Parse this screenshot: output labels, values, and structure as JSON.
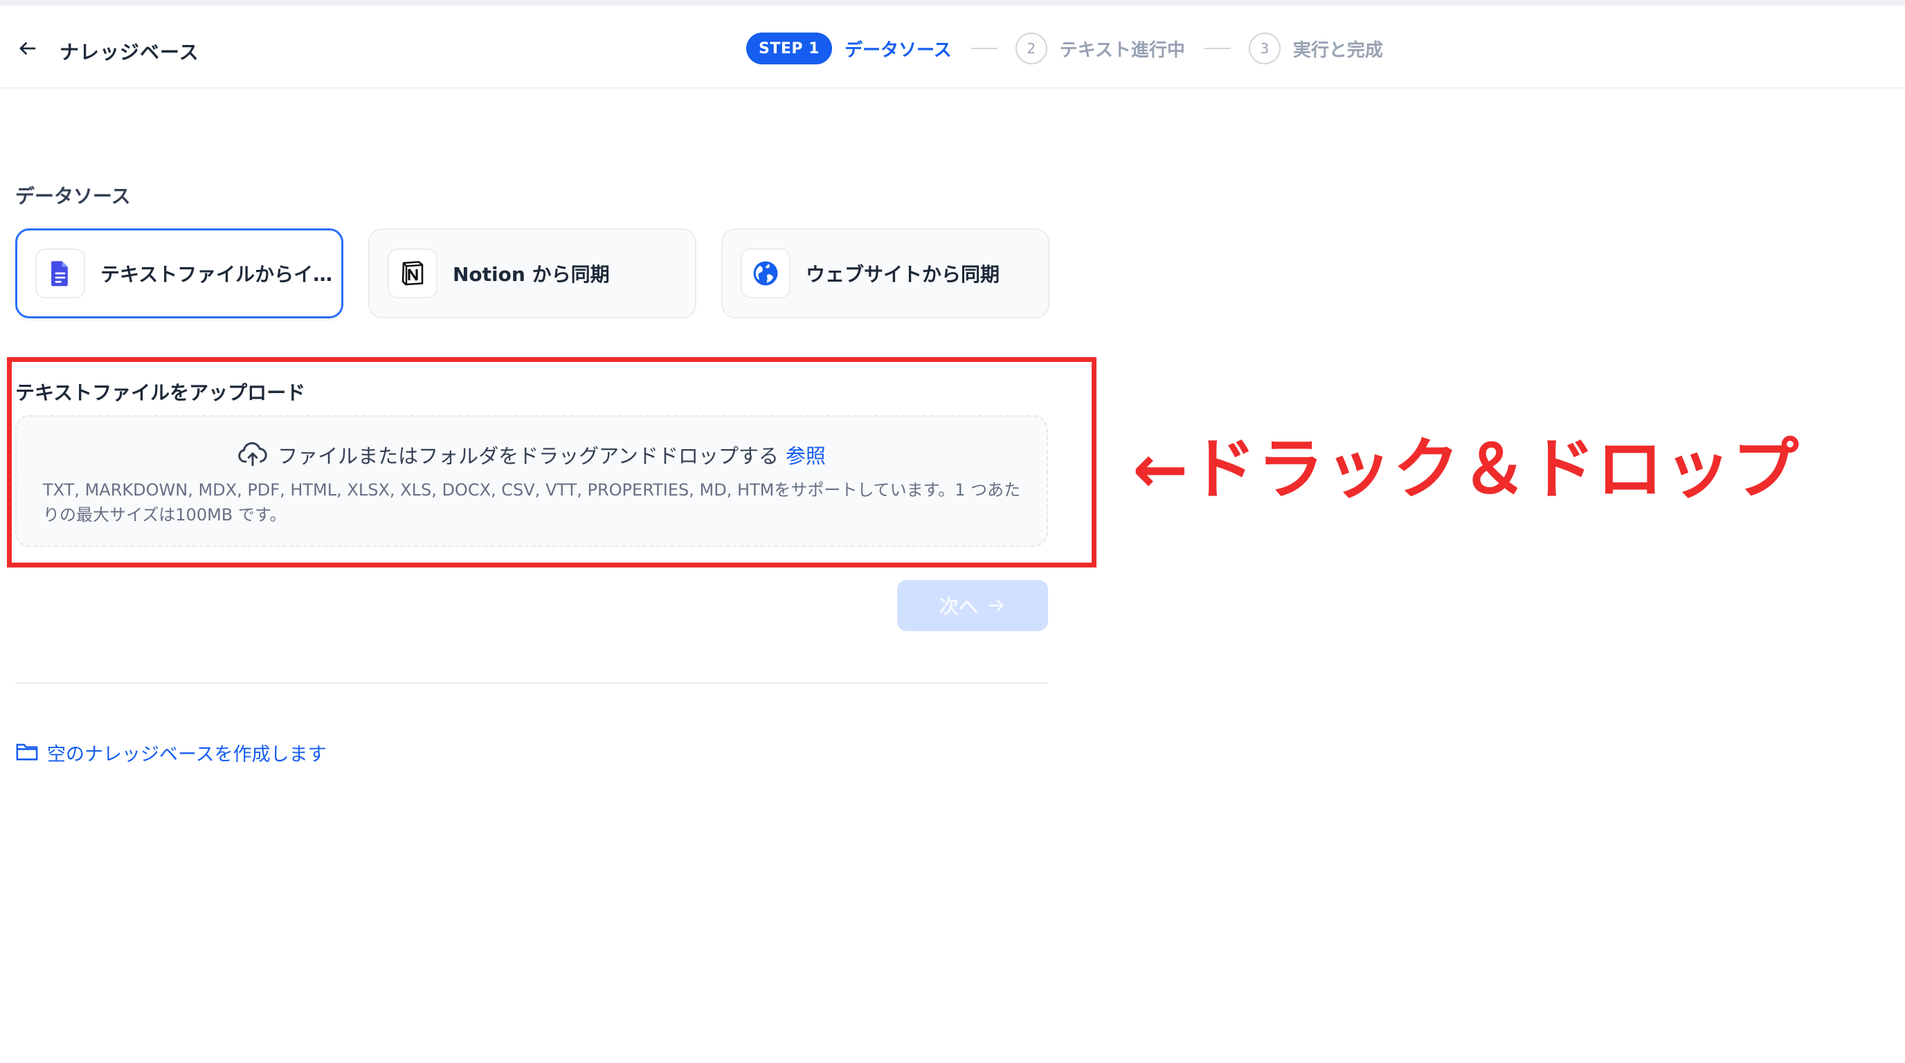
{
  "header": {
    "back_title": "ナレッジベース",
    "steps": [
      {
        "badge": "STEP 1",
        "label": "データソース",
        "active": true
      },
      {
        "number": "2",
        "label": "テキスト進行中",
        "active": false
      },
      {
        "number": "3",
        "label": "実行と完成",
        "active": false
      }
    ]
  },
  "data_source": {
    "section_title": "データソース",
    "options": [
      {
        "label": "テキストファイルからイン…",
        "icon": "file-text-icon",
        "selected": true
      },
      {
        "label": "Notion から同期",
        "icon": "notion-icon",
        "selected": false
      },
      {
        "label": "ウェブサイトから同期",
        "icon": "globe-icon",
        "selected": false
      }
    ]
  },
  "upload": {
    "title": "テキストファイルをアップロード",
    "drop_text": "ファイルまたはフォルダをドラッグアンドドロップする",
    "browse_label": "参照",
    "formats_text": "TXT, MARKDOWN, MDX, PDF, HTML, XLSX, XLS, DOCX, CSV, VTT, PROPERTIES, MD, HTMをサポートしています。1 つあたりの最大サイズは100MB です。"
  },
  "annotation": {
    "text": "←ドラック＆ドロップ",
    "color": "#ef2b2b"
  },
  "actions": {
    "next_label": "次へ",
    "empty_kb_label": "空のナレッジベースを作成します"
  },
  "colors": {
    "accent": "#155eef",
    "annotation": "#ef2b2b",
    "disabled_button": "#d1e0ff"
  }
}
